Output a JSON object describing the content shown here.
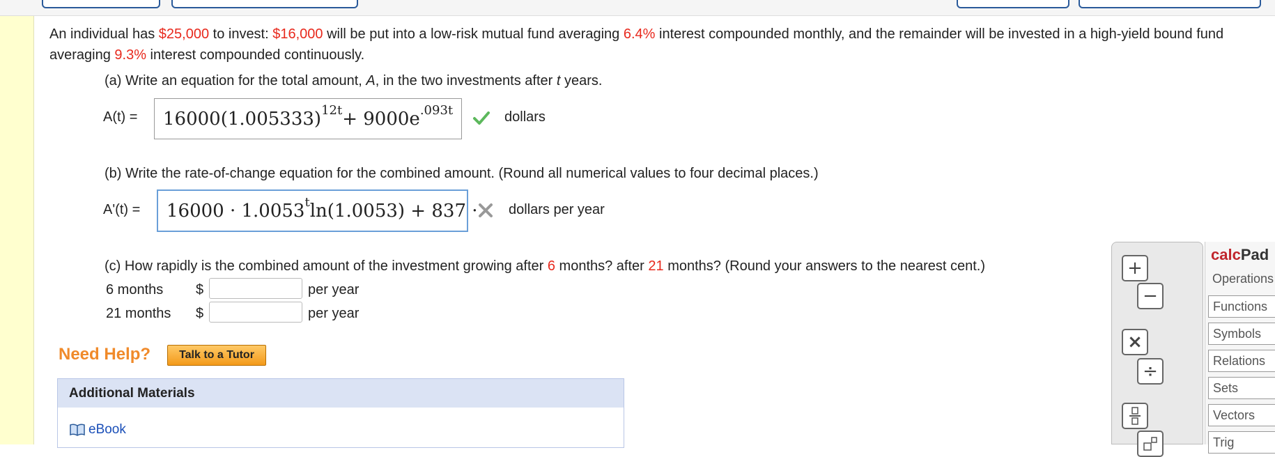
{
  "problem": {
    "pre1": "An individual has ",
    "total": "$25,000",
    "pre2": " to invest: ",
    "amount_fund": "$16,000",
    "pre3": " will be put into a low-risk mutual fund averaging ",
    "rate_monthly": "6.4%",
    "pre4": " interest compounded monthly, and the remainder will be invested in a high-yield bound fund averaging ",
    "rate_continuous": "9.3%",
    "pre5": " interest compounded continuously."
  },
  "part_a": {
    "prompt_start": "(a) Write an equation for the total amount, ",
    "prompt_var_A": "A",
    "prompt_mid": ", in the two investments after ",
    "prompt_var_t": "t",
    "prompt_end": " years.",
    "label": "A(t) =",
    "answer_main": "16000(1.005333)",
    "answer_exp1": "12t",
    "answer_mid": " + 9000e",
    "answer_exp2": ".093t",
    "unit": "dollars",
    "status": "correct"
  },
  "part_b": {
    "prompt": "(b) Write the rate-of-change equation for the combined amount. (Round all numerical values to four decimal places.)",
    "label": "A'(t) =",
    "answer_main": "16000 · 1.0053",
    "answer_exp": "t",
    "answer_rest": "ln(1.0053) + 837 ·",
    "unit": "dollars per year",
    "status": "incorrect"
  },
  "part_c": {
    "prompt_start": "(c) How rapidly is the combined amount of the investment growing after ",
    "months1": "6",
    "prompt_mid": " months? after ",
    "months2": "21",
    "prompt_end": " months? (Round your answers to the nearest cent.)",
    "rows": [
      {
        "label": "6 months",
        "currency": "$",
        "value": "",
        "unit": "per year"
      },
      {
        "label": "21 months",
        "currency": "$",
        "value": "",
        "unit": "per year"
      }
    ]
  },
  "help": {
    "label": "Need Help?",
    "tutor_button": "Talk to a Tutor"
  },
  "additional": {
    "title": "Additional Materials",
    "ebook": "eBook"
  },
  "calcpad": {
    "title_red": "calc",
    "title_dark": "Pad",
    "tabs": [
      "Operations",
      "Functions",
      "Symbols",
      "Relations",
      "Sets",
      "Vectors",
      "Trig"
    ],
    "buttons": [
      "+",
      "−",
      "×",
      "÷",
      "fraction",
      "exponent"
    ]
  },
  "colors": {
    "highlight": "#e8291d",
    "correct": "#5cb85c",
    "incorrect": "#999999",
    "help": "#f08a2a"
  }
}
